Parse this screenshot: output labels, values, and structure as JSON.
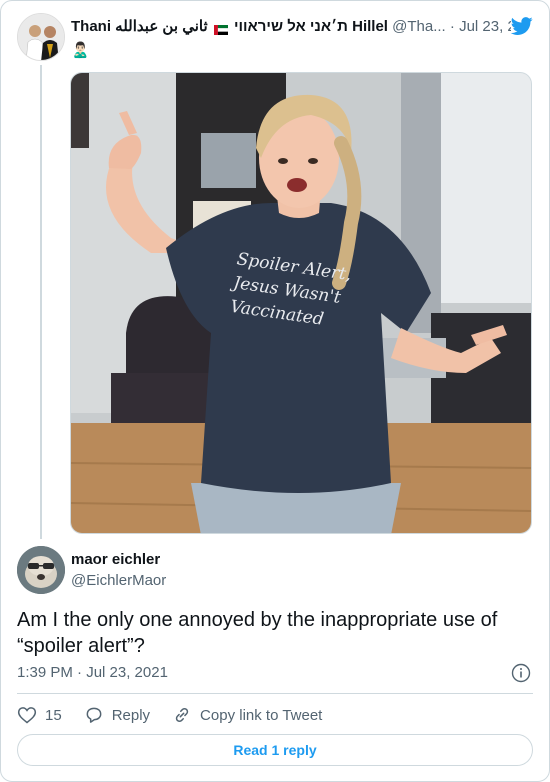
{
  "quoted": {
    "name": "Thani ת׳אני אל שיראווי",
    "name_tail": "ثاني بن عبدالله Hillel",
    "handle": "@Tha...",
    "separator": "·",
    "date": "Jul 23, 2021",
    "emoji": "🙎🏻‍♂️"
  },
  "media": {
    "shirt_text": [
      "Spoiler Alert,",
      "Jesus Wasn't",
      "Vaccinated"
    ]
  },
  "tweet": {
    "name": "maor eichler",
    "handle": "@EichlerMaor",
    "text": "Am I the only one annoyed by the inappropriate use of “spoiler alert”?",
    "timestamp": "1:39 PM · Jul 23, 2021"
  },
  "actions": {
    "likes": "15",
    "reply": "Reply",
    "copy_link": "Copy link to Tweet"
  },
  "read_reply": "Read 1 reply",
  "colors": {
    "accent": "#1d9bf0",
    "secondary_text": "#536471",
    "border": "#cfd9de"
  }
}
